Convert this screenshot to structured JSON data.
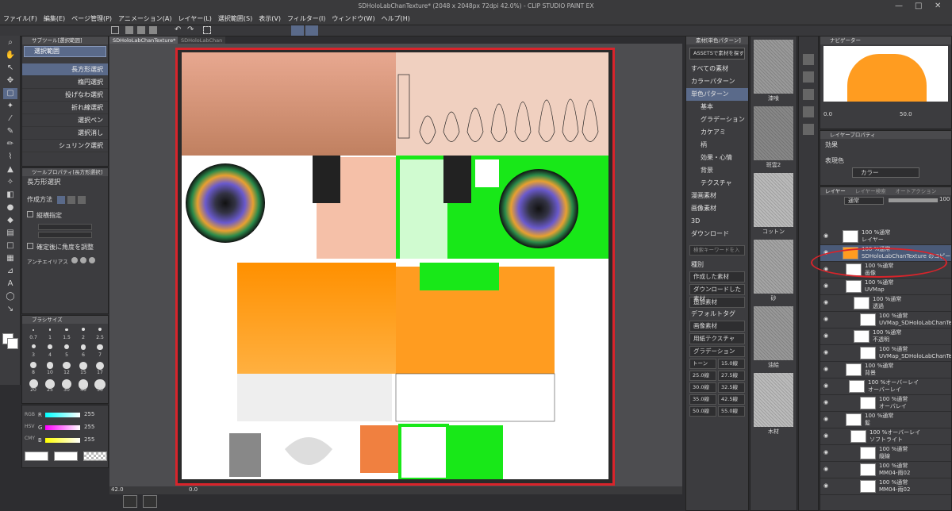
{
  "window": {
    "title": "SDHoloLabChanTexture* (2048 x 2048px 72dpi 42.0%) - CLIP STUDIO PAINT EX",
    "controls": [
      "—",
      "□",
      "✕"
    ]
  },
  "menu": [
    "ファイル(F)",
    "編集(E)",
    "ページ管理(P)",
    "アニメーション(A)",
    "レイヤー(L)",
    "選択範囲(S)",
    "表示(V)",
    "フィルター(I)",
    "ウィンドウ(W)",
    "ヘルプ(H)"
  ],
  "tabs": [
    "SDHoloLabChanTexture*",
    "SDHoloLabChan"
  ],
  "subtool": {
    "title": "サブツール[選択範囲]",
    "group": "選択範囲",
    "items": [
      "長方形選択",
      "楕円選択",
      "投げなわ選択",
      "折れ線選択",
      "選択ペン",
      "選択消し",
      "シュリンク選択"
    ]
  },
  "tool_property": {
    "title": "ツールプロパティ[長方形選択]",
    "name": "長方形選択",
    "mode_label": "作成方法",
    "aspect_label": "縦横指定",
    "angle_label": "確定後に角度を調整",
    "antialias_label": "アンチエイリアス"
  },
  "brush_size": {
    "title": "ブラシサイズ",
    "sizes": [
      "0.7",
      "1",
      "1.5",
      "2",
      "2.5",
      "3",
      "4",
      "5",
      "6",
      "7",
      "8",
      "10",
      "12",
      "15",
      "17",
      "20",
      "25",
      "30",
      "40",
      "50"
    ]
  },
  "color": {
    "r_label": "R",
    "g_label": "G",
    "b_label": "B",
    "r": "255",
    "g": "255",
    "b": "255"
  },
  "canvas": {
    "zoom": "42.0",
    "rotation": "0.0"
  },
  "materials": {
    "title": "素材[単色パターン]",
    "assets_button": "ASSETSで素材を探す",
    "tree": [
      "すべての素材",
      "カラーパターン",
      "単色パターン",
      "基本",
      "グラデーション",
      "カケアミ",
      "柄",
      "効果・心情",
      "背景",
      "テクスチャ",
      "漫画素材",
      "画像素材",
      "3D",
      "ダウンロード"
    ],
    "search_placeholder": "検索キーワードを入",
    "kind_label": "種別",
    "kind_items": [
      "作成した素材",
      "ダウンロードした素材",
      "追加素材"
    ],
    "default_tag_label": "デフォルトタグ",
    "tags": [
      "画像素材",
      "用紙テクスチャ",
      "グラデーション"
    ],
    "tone_rows": [
      [
        "トーン",
        "15.0線"
      ],
      [
        "25.0線",
        "27.5線"
      ],
      [
        "30.0線",
        "32.5線"
      ],
      [
        "35.0線",
        "42.5線"
      ],
      [
        "50.0線",
        "55.0線"
      ]
    ],
    "thumbs": [
      "漆喰",
      "斑雲2",
      "コットン",
      "砂",
      "油絵",
      "木材"
    ]
  },
  "navigator": {
    "title": "ナビゲーター",
    "zoom": "50.0",
    "rotation": "0.0"
  },
  "layer_property": {
    "title": "レイヤープロパティ",
    "effect_label": "効果",
    "expression_label": "表現色",
    "expression_value": "カラー"
  },
  "layers_panel": {
    "tabs": [
      "レイヤー",
      "レイヤー検索",
      "オートアクション"
    ],
    "blend": "通常",
    "opacity": "100",
    "rows": [
      {
        "mode": "100 %通常",
        "name": "レイヤー"
      },
      {
        "mode": "100 %通常",
        "name": "SDHoloLabChanTexture のコピー"
      },
      {
        "mode": "100 %通常",
        "name": "画像"
      },
      {
        "mode": "100 %通常",
        "name": "UVMap"
      },
      {
        "mode": "100 %通常",
        "name": "透過"
      },
      {
        "mode": "100 %通常",
        "name": "UVMap_SDHoloLabChanTexture"
      },
      {
        "mode": "100 %通常",
        "name": "不透明"
      },
      {
        "mode": "100 %通常",
        "name": "UVMap_SDHoloLabChanTexture"
      },
      {
        "mode": "100 %通常",
        "name": "背景"
      },
      {
        "mode": "100 %オーバーレイ",
        "name": "オーバーレイ"
      },
      {
        "mode": "100 %通常",
        "name": "オーバレイ"
      },
      {
        "mode": "100 %通常",
        "name": "髪"
      },
      {
        "mode": "100 %オーバーレイ",
        "name": "ソフトライト"
      },
      {
        "mode": "100 %通常",
        "name": "縦線"
      },
      {
        "mode": "100 %通常",
        "name": "MM04-雨02"
      },
      {
        "mode": "100 %通常",
        "name": "MM04-雨02"
      }
    ]
  }
}
